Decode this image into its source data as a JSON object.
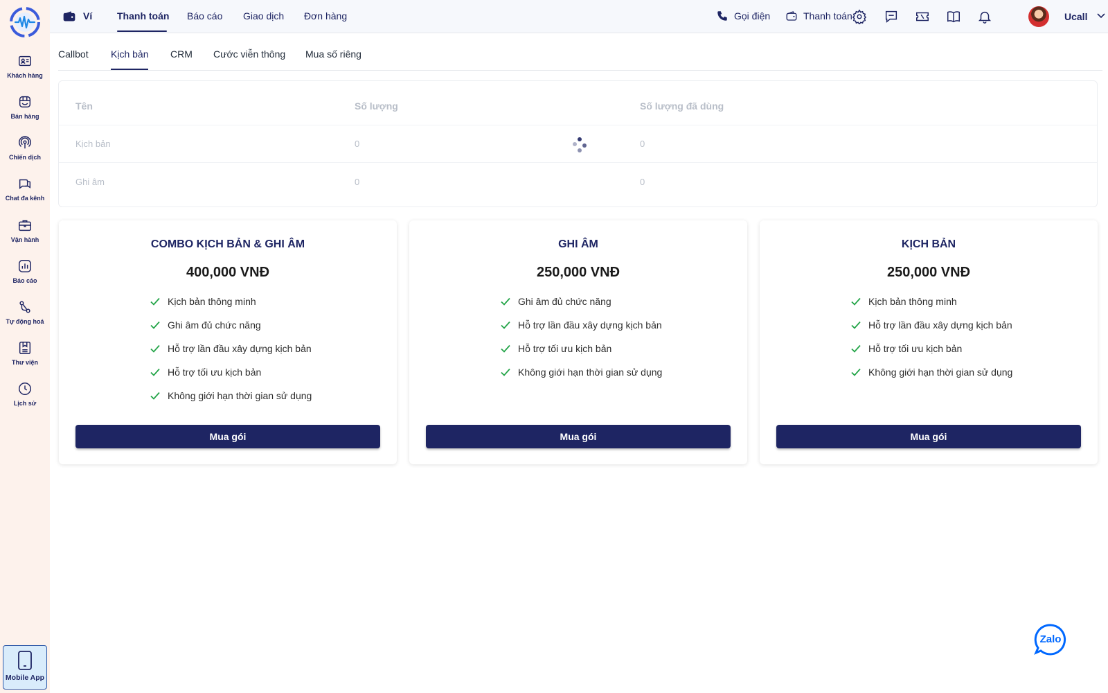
{
  "sidebar": {
    "items": [
      {
        "label": "Khách hàng",
        "icon": "contact-card-icon"
      },
      {
        "label": "Bán hàng",
        "icon": "store-icon"
      },
      {
        "label": "Chiến dịch",
        "icon": "broadcast-icon"
      },
      {
        "label": "Chat đa kênh",
        "icon": "chat-icon"
      },
      {
        "label": "Vận hành",
        "icon": "briefcase-icon"
      },
      {
        "label": "Báo cáo",
        "icon": "report-chart-icon"
      },
      {
        "label": "Tự động hoá",
        "icon": "automation-icon"
      },
      {
        "label": "Thư viện",
        "icon": "library-icon"
      },
      {
        "label": "Lịch sử",
        "icon": "clock-icon"
      }
    ],
    "mobile_app_label": "Mobile App"
  },
  "header": {
    "wallet_label": "Ví",
    "tabs": [
      "Thanh toán",
      "Báo cáo",
      "Giao dịch",
      "Đơn hàng"
    ],
    "active_tab": "Thanh toán",
    "call_label": "Gọi điện",
    "payment_label": "Thanh toán",
    "user_name": "Ucall"
  },
  "subtabs": {
    "items": [
      "Callbot",
      "Kịch bản",
      "CRM",
      "Cước viễn thông",
      "Mua số riêng"
    ],
    "active": "Kịch bản"
  },
  "usage_table": {
    "columns": [
      "Tên",
      "Số lượng",
      "Số lượng đã dùng"
    ],
    "rows": [
      {
        "name": "Kịch bản",
        "quantity": "0",
        "used": "0"
      },
      {
        "name": "Ghi âm",
        "quantity": "0",
        "used": "0"
      }
    ]
  },
  "plans": [
    {
      "title": "COMBO KỊCH BẢN & GHI ÂM",
      "price": "400,000 VNĐ",
      "features": [
        "Kịch bản thông minh",
        "Ghi âm đủ chức năng",
        "Hỗ trợ lần đầu xây dựng kịch bản",
        "Hỗ trợ tối ưu kịch bản",
        "Không giới hạn thời gian sử dụng"
      ],
      "button": "Mua gói"
    },
    {
      "title": "GHI ÂM",
      "price": "250,000 VNĐ",
      "features": [
        "Ghi âm đủ chức năng",
        "Hỗ trợ lần đầu xây dựng kịch bản",
        "Hỗ trợ tối ưu kịch bản",
        "Không giới hạn thời gian sử dụng"
      ],
      "button": "Mua gói"
    },
    {
      "title": "KỊCH BẢN",
      "price": "250,000 VNĐ",
      "features": [
        "Kịch bản thông minh",
        "Hỗ trợ lần đầu xây dựng kịch bản",
        "Hỗ trợ tối ưu kịch bản",
        "Không giới hạn thời gian sử dụng"
      ],
      "button": "Mua gói"
    }
  ],
  "colors": {
    "primary": "#1e2563",
    "sidebar_bg": "#fdf2ec",
    "check": "#22a447",
    "zalo": "#0068ff"
  },
  "zalo_label": "Zalo"
}
